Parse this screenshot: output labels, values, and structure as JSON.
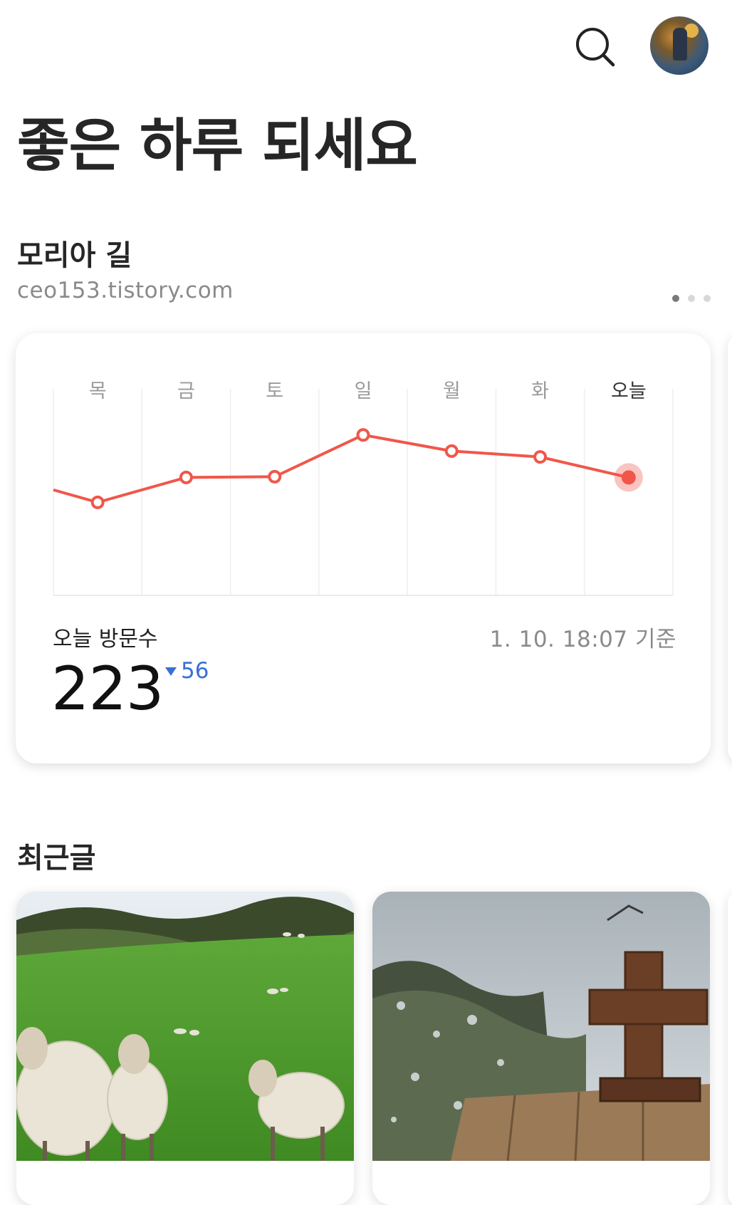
{
  "header": {
    "search_icon": "search-icon",
    "avatar_icon": "profile-avatar"
  },
  "greeting": "좋은 하루 되세요",
  "blog": {
    "name": "모리아 길",
    "url": "ceo153.tistory.com",
    "page_dots": 3,
    "active_dot": 0
  },
  "stats": {
    "today_label": "오늘 방문수",
    "timestamp": "1. 10. 18:07 기준",
    "today_visits": "223",
    "delta": "56",
    "delta_direction": "down",
    "line_color": "#f0574a",
    "delta_color": "#3a6fd8"
  },
  "chart_data": {
    "type": "line",
    "categories": [
      "목",
      "금",
      "토",
      "일",
      "월",
      "화",
      "오늘"
    ],
    "series": [
      {
        "values": [
          227,
          261,
          262,
          319,
          297,
          289,
          261
        ]
      }
    ],
    "lead_in_value": 244,
    "ylim": [
      100,
      380
    ],
    "grid": true,
    "highlight_last": true
  },
  "recent": {
    "title": "최근글",
    "posts": [
      {
        "thumb": "sheep-on-green-hill-image"
      },
      {
        "thumb": "wooden-cross-in-snow-image"
      }
    ]
  }
}
